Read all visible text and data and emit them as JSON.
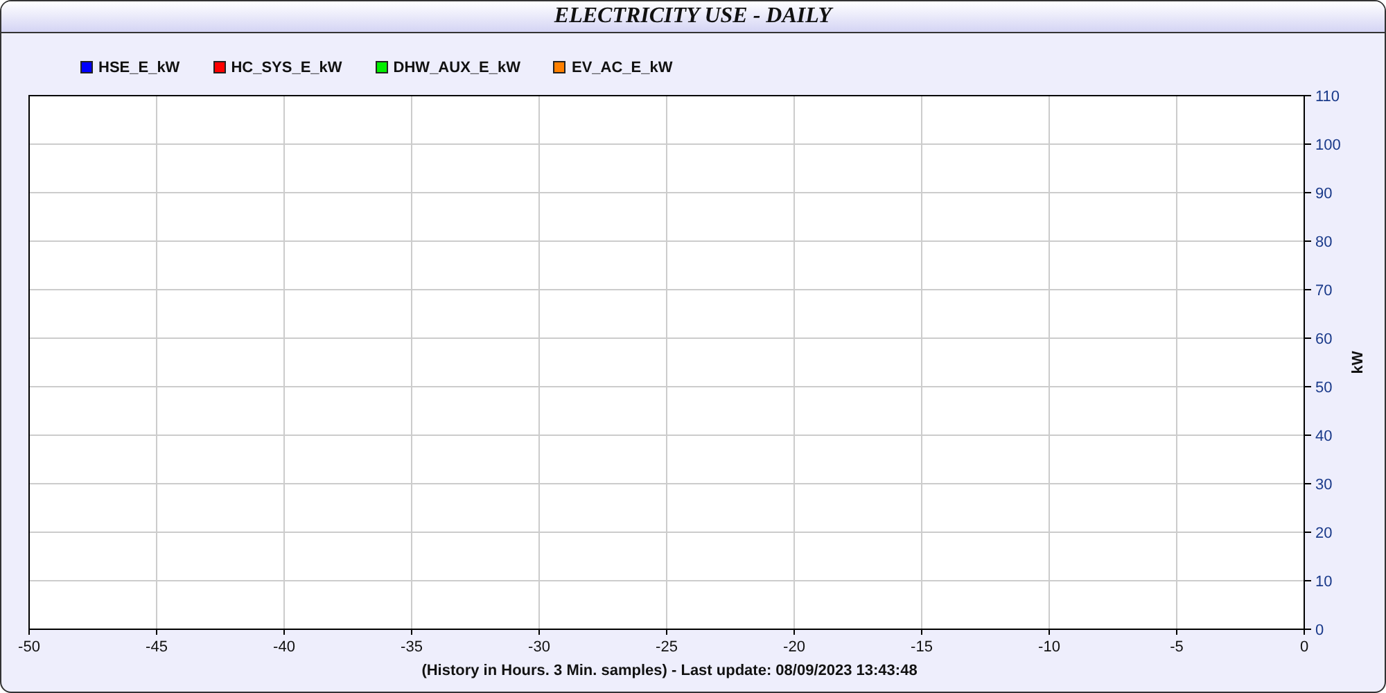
{
  "window": {
    "title": "ELECTRICITY USE - DAILY"
  },
  "chart_data": {
    "type": "line",
    "xlabel": "(History in Hours. 3 Min. samples) - Last update: 08/09/2023 13:43:48",
    "ylabel": "kW",
    "grid": true,
    "ylim": [
      0,
      110
    ],
    "categories": [
      "-50",
      "-45",
      "-40",
      "-35",
      "-30",
      "-25",
      "-20",
      "-15",
      "-10",
      "-5",
      "0"
    ],
    "yticks": [
      0,
      10,
      20,
      30,
      40,
      50,
      60,
      70,
      80,
      90,
      100,
      110
    ],
    "series": [
      {
        "name": "HSE_E_kW",
        "color": "#0000ff",
        "values": [
          null,
          null,
          null,
          null,
          null,
          null,
          null,
          null,
          null,
          null,
          null
        ]
      },
      {
        "name": "HC_SYS_E_kW",
        "color": "#ff0000",
        "values": [
          null,
          null,
          null,
          null,
          null,
          null,
          null,
          null,
          null,
          null,
          null
        ]
      },
      {
        "name": "DHW_AUX_E_kW",
        "color": "#00ee00",
        "values": [
          null,
          null,
          null,
          null,
          null,
          null,
          null,
          null,
          null,
          null,
          null
        ]
      },
      {
        "name": "EV_AC_E_kW",
        "color": "#ff8000",
        "values": [
          null,
          null,
          null,
          null,
          null,
          null,
          null,
          null,
          null,
          null,
          null
        ]
      }
    ]
  }
}
